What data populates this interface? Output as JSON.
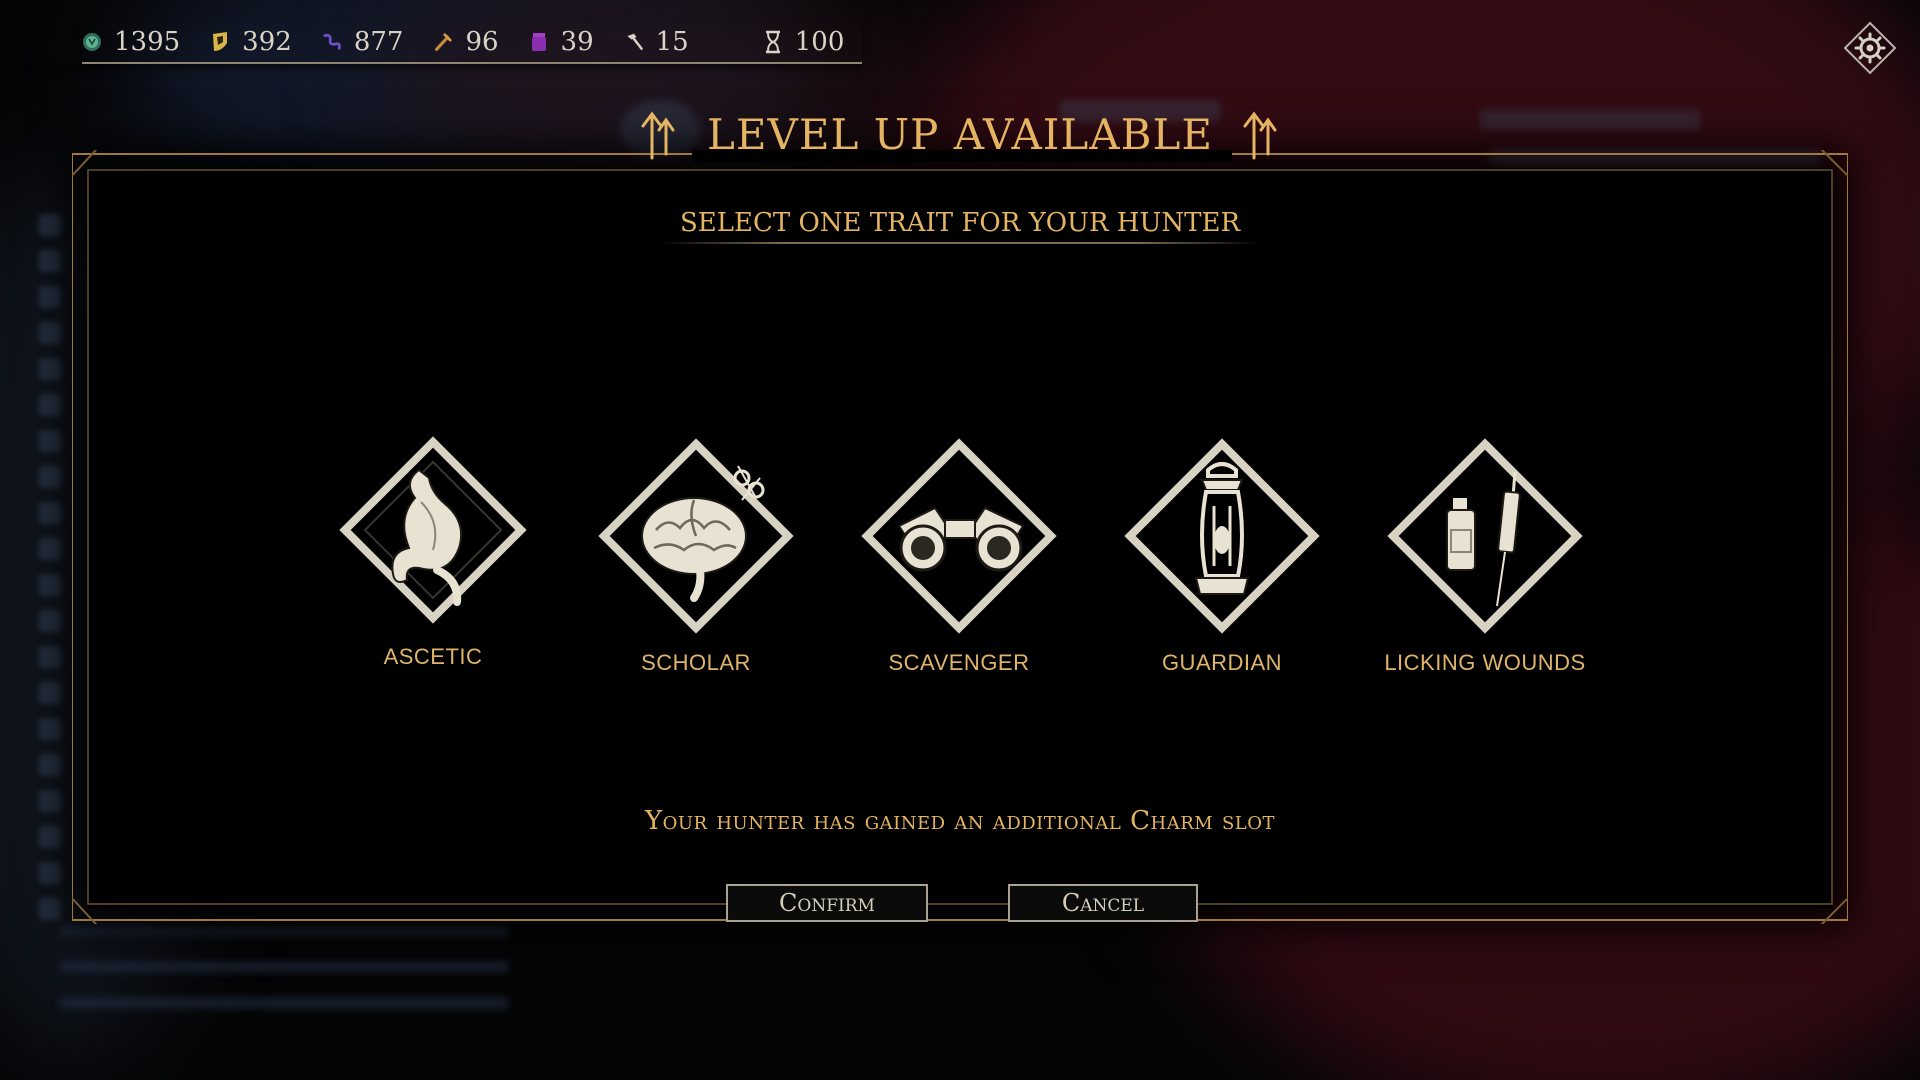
{
  "resources": [
    {
      "icon": "green-coin-icon",
      "value": "1395",
      "color": "#4fa083"
    },
    {
      "icon": "gold-shield-icon",
      "value": "392",
      "color": "#d8b44a"
    },
    {
      "icon": "purple-tendril-icon",
      "value": "877",
      "color": "#6f4fc9"
    },
    {
      "icon": "orange-tool-icon",
      "value": "96",
      "color": "#c88a3a"
    },
    {
      "icon": "purple-vial-icon",
      "value": "39",
      "color": "#a43dc7"
    },
    {
      "icon": "hammer-icon",
      "value": "15",
      "color": "#d9d3c6"
    },
    {
      "icon": "hourglass-icon",
      "value": "100",
      "color": "#d9d3c6"
    }
  ],
  "modal": {
    "title": "LEVEL UP AVAILABLE",
    "subtitle": "SELECT ONE TRAIT FOR YOUR HUNTER",
    "message": "Your hunter has gained an additional Charm slot",
    "confirm_label": "Confirm",
    "cancel_label": "Cancel"
  },
  "traits": [
    {
      "label": "ASCETIC",
      "icon": "stomach-icon"
    },
    {
      "label": "SCHOLAR",
      "icon": "brain-icon"
    },
    {
      "label": "SCAVENGER",
      "icon": "binoculars-icon"
    },
    {
      "label": "GUARDIAN",
      "icon": "lantern-icon"
    },
    {
      "label": "LICKING WOUNDS",
      "icon": "syringe-bottle-icon"
    }
  ],
  "colors": {
    "accent": "#e4b462",
    "frame": "#a07a3c",
    "icon_fill": "#e8e2d2"
  }
}
